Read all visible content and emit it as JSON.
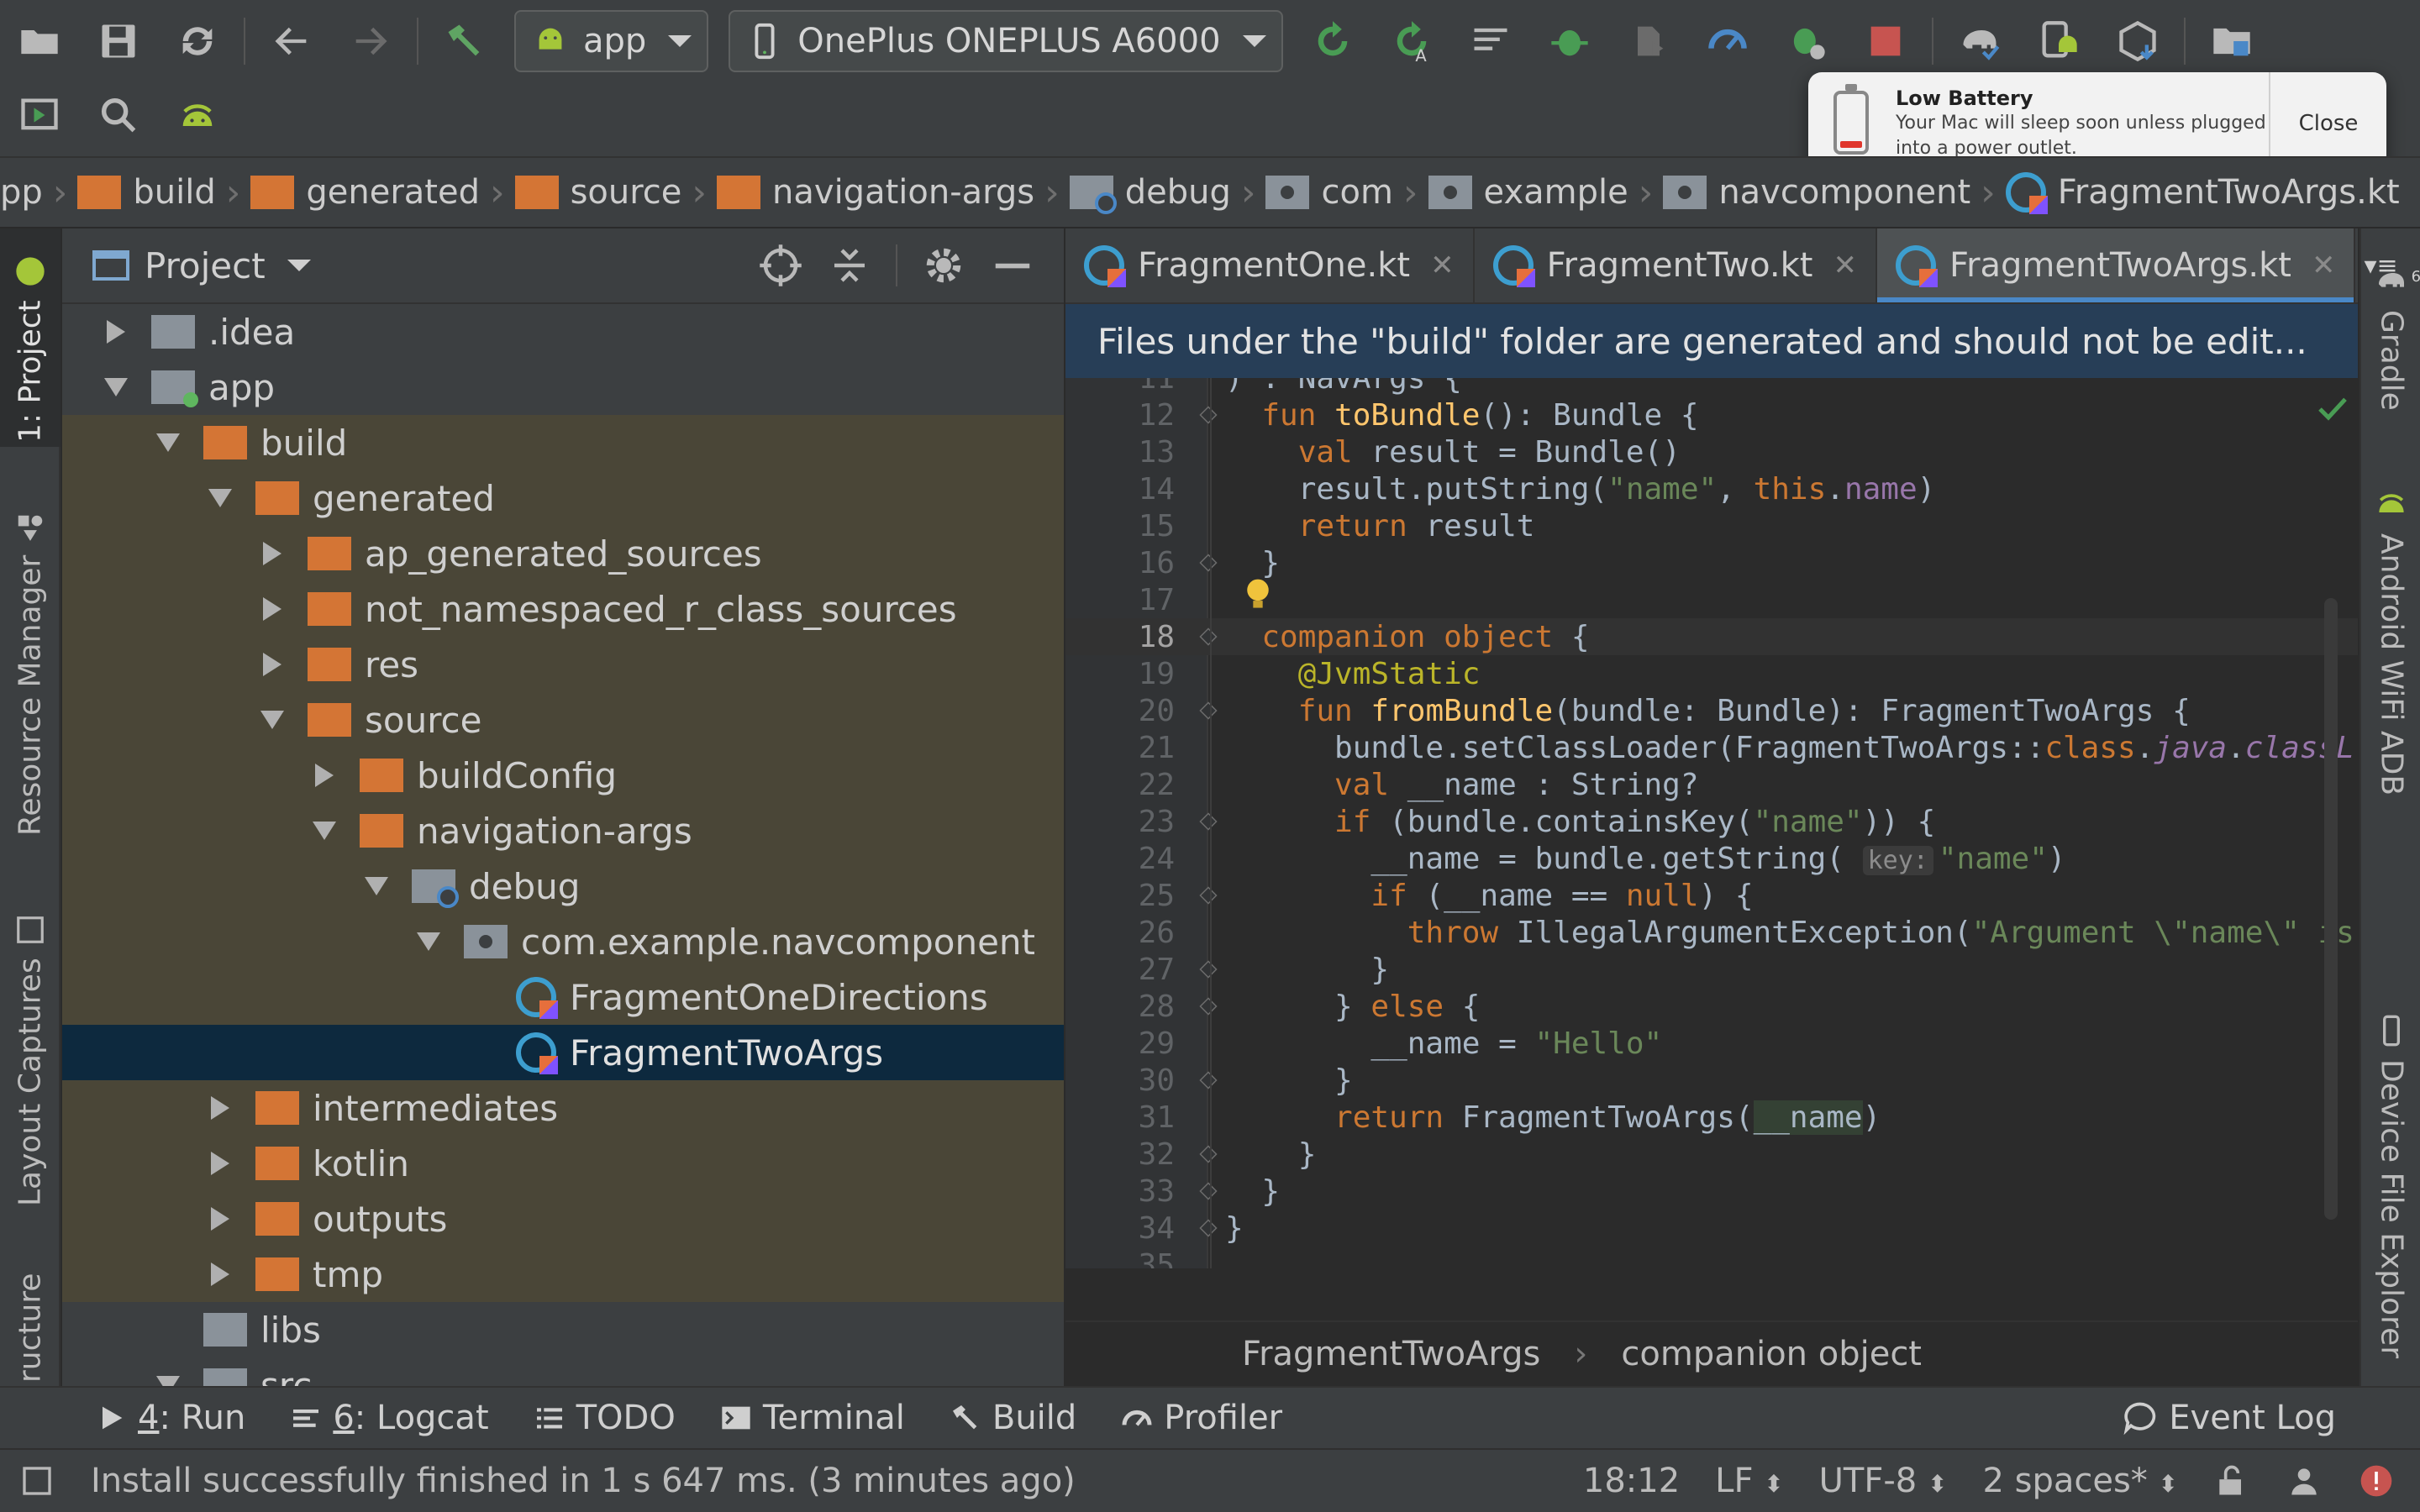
{
  "toolbar": {
    "config_combo": "app",
    "device_combo": "OnePlus ONEPLUS A6000"
  },
  "breadcrumb": [
    "pp",
    "build",
    "generated",
    "source",
    "navigation-args",
    "debug",
    "com",
    "example",
    "navcomponent",
    "FragmentTwoArgs.kt"
  ],
  "notification": {
    "title": "Low Battery",
    "message_line1": "Your Mac will sleep soon unless plugged",
    "message_line2": "into a power outlet.",
    "close_label": "Close"
  },
  "left_strip": {
    "project": "1: Project",
    "resource_manager": "Resource Manager",
    "layout_captures": "Layout Captures",
    "structure": "ructure"
  },
  "right_strip": {
    "gradle": "Gradle",
    "wifi_adb": "Android WiFi ADB",
    "device_file_explorer": "Device File Explorer"
  },
  "project": {
    "title": "Project",
    "tree": [
      {
        "label": ".idea",
        "depth": 0,
        "expanded": false,
        "icon": "folder-gray"
      },
      {
        "label": "app",
        "depth": 0,
        "expanded": true,
        "icon": "module"
      },
      {
        "label": "build",
        "depth": 1,
        "expanded": true,
        "icon": "folder-orange"
      },
      {
        "label": "generated",
        "depth": 2,
        "expanded": true,
        "icon": "folder-orange"
      },
      {
        "label": "ap_generated_sources",
        "depth": 3,
        "expanded": false,
        "icon": "folder-orange"
      },
      {
        "label": "not_namespaced_r_class_sources",
        "depth": 3,
        "expanded": false,
        "icon": "folder-orange"
      },
      {
        "label": "res",
        "depth": 3,
        "expanded": false,
        "icon": "folder-orange"
      },
      {
        "label": "source",
        "depth": 3,
        "expanded": true,
        "icon": "folder-orange"
      },
      {
        "label": "buildConfig",
        "depth": 4,
        "expanded": false,
        "icon": "folder-orange"
      },
      {
        "label": "navigation-args",
        "depth": 4,
        "expanded": true,
        "icon": "folder-orange"
      },
      {
        "label": "debug",
        "depth": 5,
        "expanded": true,
        "icon": "folder-source"
      },
      {
        "label": "com.example.navcomponent",
        "depth": 6,
        "expanded": true,
        "icon": "package"
      },
      {
        "label": "FragmentOneDirections",
        "depth": 7,
        "expanded": null,
        "icon": "kotlin-file"
      },
      {
        "label": "FragmentTwoArgs",
        "depth": 7,
        "expanded": null,
        "icon": "kotlin-file"
      },
      {
        "label": "intermediates",
        "depth": 2,
        "expanded": false,
        "icon": "folder-orange"
      },
      {
        "label": "kotlin",
        "depth": 2,
        "expanded": false,
        "icon": "folder-orange"
      },
      {
        "label": "outputs",
        "depth": 2,
        "expanded": false,
        "icon": "folder-orange"
      },
      {
        "label": "tmp",
        "depth": 2,
        "expanded": false,
        "icon": "folder-orange"
      },
      {
        "label": "libs",
        "depth": 1,
        "expanded": null,
        "icon": "folder-gray"
      },
      {
        "label": "src",
        "depth": 1,
        "expanded": true,
        "icon": "folder-gray"
      }
    ]
  },
  "editor": {
    "tabs": [
      {
        "label": "FragmentOne.kt",
        "active": false
      },
      {
        "label": "FragmentTwo.kt",
        "active": false
      },
      {
        "label": "FragmentTwoArgs.kt",
        "active": true
      }
    ],
    "tab_overflow_count": "6",
    "banner": "Files under the \"build\" folder are generated and should not be edit...",
    "code": [
      {
        "n": "11",
        "html": ") : NavArgs {"
      },
      {
        "n": "12",
        "html": "  <span class=\"kw\">fun</span> <span class=\"fn\">toBundle</span>(): Bundle {"
      },
      {
        "n": "13",
        "html": "    <span class=\"kw\">val</span> result = Bundle()"
      },
      {
        "n": "14",
        "html": "    result.putString(<span class=\"str\">\"name\"</span>, <span class=\"kw\">this</span>.<span class=\"prop\">name</span>)"
      },
      {
        "n": "15",
        "html": "    <span class=\"kw\">return</span> result"
      },
      {
        "n": "16",
        "html": "  }"
      },
      {
        "n": "17",
        "html": ""
      },
      {
        "n": "18",
        "html": "  <span class=\"kw\">companion object</span> {"
      },
      {
        "n": "19",
        "html": "    <span class=\"ann\">@JvmStatic</span>"
      },
      {
        "n": "20",
        "html": "    <span class=\"kw\">fun</span> <span class=\"fn\">fromBundle</span>(bundle: Bundle): FragmentTwoArgs {"
      },
      {
        "n": "21",
        "html": "      bundle.setClassLoader(FragmentTwoArgs::<span class=\"kw\">class</span>.<span class=\"it\">java</span>.<span class=\"it\">classL</span>"
      },
      {
        "n": "22",
        "html": "      <span class=\"kw\">val</span> __name : String?"
      },
      {
        "n": "23",
        "html": "      <span class=\"kw\">if</span> (bundle.containsKey(<span class=\"str\">\"name\"</span>)) {"
      },
      {
        "n": "24",
        "html": "        __name = bundle.getString( <span class=\"hint\">key:</span><span class=\"str\">\"name\"</span>)"
      },
      {
        "n": "25",
        "html": "        <span class=\"kw\">if</span> (__name == <span class=\"kw\">null</span>) {"
      },
      {
        "n": "26",
        "html": "          <span class=\"kw\">throw</span> IllegalArgumentException(<span class=\"str\">\"Argument \\\"name\\\" is</span>"
      },
      {
        "n": "27",
        "html": "        }"
      },
      {
        "n": "28",
        "html": "      } <span class=\"kw\">else</span> {"
      },
      {
        "n": "29",
        "html": "        __name = <span class=\"str\">\"Hello\"</span>"
      },
      {
        "n": "30",
        "html": "      }"
      },
      {
        "n": "31",
        "html": "      <span class=\"kw\">return</span> FragmentTwoArgs(<span class=\"uline\">__name</span>)"
      },
      {
        "n": "32",
        "html": "    }"
      },
      {
        "n": "33",
        "html": "  }"
      },
      {
        "n": "34",
        "html": "}"
      },
      {
        "n": "35",
        "html": ""
      }
    ],
    "current_line": "18",
    "crumbs": [
      "FragmentTwoArgs",
      "companion object"
    ]
  },
  "bottom_tabs": [
    {
      "num": "4",
      "label": ": Run",
      "icon": "run-icon"
    },
    {
      "num": "6",
      "label": ": Logcat",
      "icon": "logcat-icon"
    },
    {
      "num": "",
      "label": "TODO",
      "icon": "todo-icon"
    },
    {
      "num": "",
      "label": "Terminal",
      "icon": "terminal-icon"
    },
    {
      "num": "",
      "label": "Build",
      "icon": "hammer-icon"
    },
    {
      "num": "",
      "label": "Profiler",
      "icon": "profiler-icon"
    }
  ],
  "event_log": "Event Log",
  "status": {
    "message": "Install successfully finished in 1 s 647 ms. (3 minutes ago)",
    "position": "18:12",
    "line_sep": "LF",
    "encoding": "UTF-8",
    "indent": "2 spaces*"
  },
  "colors": {
    "accent": "#4a88c7",
    "folder": "#d47535",
    "run_green": "#499c54",
    "stop_red": "#c75450"
  }
}
